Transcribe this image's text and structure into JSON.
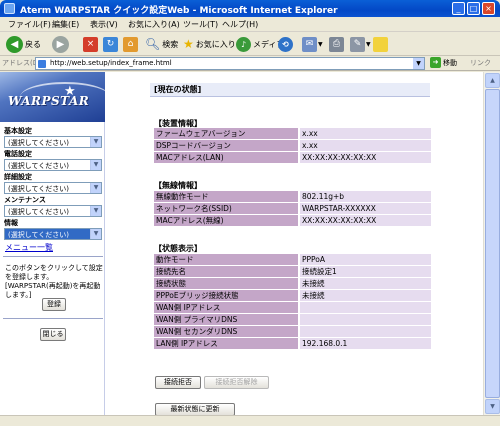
{
  "window": {
    "title": "Aterm WARPSTAR クイック設定Web - Microsoft Internet Explorer",
    "minimize": "_",
    "maximize": "□",
    "close": "×"
  },
  "menu": [
    "ファイル(F)",
    "編集(E)",
    "表示(V)",
    "お気に入り(A)",
    "ツール(T)",
    "ヘルプ(H)"
  ],
  "toolbar": {
    "back": "戻る",
    "search": "検索",
    "favorites": "お気に入り",
    "media": "メディア"
  },
  "address": {
    "label": "アドレス(D)",
    "url": "http://web.setup/index_frame.html",
    "go": "移動",
    "links": "リンク"
  },
  "sidebar": {
    "logo": "WARPSTAR",
    "groups": [
      {
        "label": "基本設定",
        "value": "(選択してください)"
      },
      {
        "label": "電話設定",
        "value": "(選択してください)"
      },
      {
        "label": "詳細設定",
        "value": "(選択してください)"
      },
      {
        "label": "メンテナンス",
        "value": "(選択してください)"
      },
      {
        "label": "情報",
        "value": "(選択してください)"
      }
    ],
    "menu_list": "メニュー一覧",
    "note": "このボタンをクリックして設定を登録します。[WARPSTAR(再起動)を再起動します。]",
    "register_button": "登録",
    "close_button": "閉じる"
  },
  "main": {
    "page_title": "[現在の状態]",
    "device_section": "【装置情報】",
    "device_rows": [
      {
        "key": "ファームウェアバージョン",
        "value": "x.xx"
      },
      {
        "key": "DSPコードバージョン",
        "value": "x.xx"
      },
      {
        "key": "MACアドレス(LAN)",
        "value": "XX:XX:XX:XX:XX:XX"
      }
    ],
    "wireless_section": "【無線情報】",
    "wireless_rows": [
      {
        "key": "無線動作モード",
        "value": "802.11g+b"
      },
      {
        "key": "ネットワーク名(SSID)",
        "value": "WARPSTAR-XXXXXX"
      },
      {
        "key": "MACアドレス(無線)",
        "value": "XX:XX:XX:XX:XX:XX"
      }
    ],
    "status_section": "【状態表示】",
    "status_rows": [
      {
        "key": "動作モード",
        "value": "PPPoA"
      },
      {
        "key": "接続先名",
        "value": "接続設定1"
      },
      {
        "key": "接続状態",
        "value": "未接続"
      },
      {
        "key": "PPPoEブリッジ接続状態",
        "value": "未接続"
      },
      {
        "key": "WAN側 IPアドレス",
        "value": ""
      },
      {
        "key": "WAN側 プライマリDNS",
        "value": ""
      },
      {
        "key": "WAN側 セカンダリDNS",
        "value": ""
      },
      {
        "key": "LAN側 IPアドレス",
        "value": "192.168.0.1"
      }
    ],
    "connect_button": "接続拒否",
    "disconnect_button": "接続拒否解除",
    "refresh_button": "最新状態に更新"
  }
}
